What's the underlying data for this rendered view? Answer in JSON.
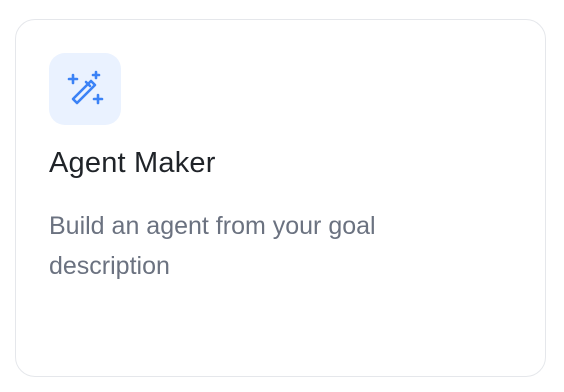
{
  "card": {
    "title": "Agent Maker",
    "description": "Build an agent from your goal description",
    "icon": "magic-wand-icon",
    "accent_color": "#3b82f6",
    "icon_bg_color": "#eaf2ff"
  }
}
